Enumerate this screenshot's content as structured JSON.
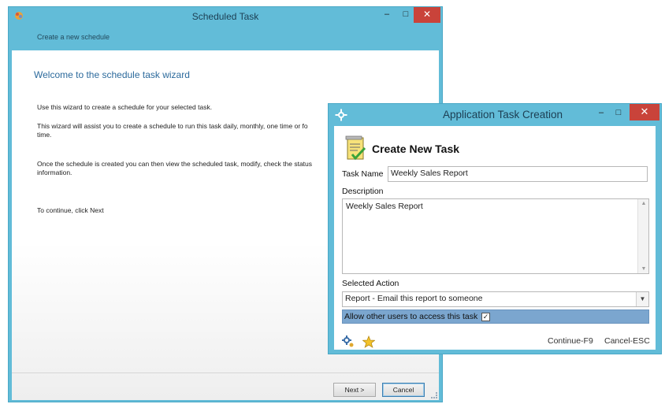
{
  "wizard": {
    "title": "Scheduled Task",
    "subheader": "Create a new schedule",
    "heading": "Welcome to the schedule task wizard",
    "para1": "Use this wizard to create a schedule for your selected task.",
    "para2_line1": "This wizard will assist you to create a schedule to run this task daily, monthly, one time or fo",
    "para2_line2": "time.",
    "para3_line1": "Once the schedule is created you can then view the scheduled task, modify, check the status",
    "para3_line2": "information.",
    "para4": "To continue, click Next",
    "next_label": "Next >",
    "cancel_label": "Cancel",
    "window_controls": {
      "minimize": "–",
      "maximize": "□",
      "close": "✕"
    }
  },
  "dialog": {
    "title": "Application Task Creation",
    "heading": "Create New Task",
    "task_name_label": "Task Name",
    "task_name_value": "Weekly Sales Report",
    "description_label": "Description",
    "description_value": "Weekly Sales Report",
    "selected_action_label": "Selected Action",
    "selected_action_value": "Report - Email this report to someone",
    "allow_label": "Allow other users to access this task",
    "allow_checked": true,
    "continue_label": "Continue-F9",
    "cancel_label": "Cancel-ESC",
    "window_controls": {
      "minimize": "–",
      "maximize": "□",
      "close": "✕"
    },
    "icons": [
      "gear-icon",
      "task-document-icon",
      "settings-icon",
      "star-icon"
    ]
  },
  "colors": {
    "chrome": "#62bcd8",
    "close_button": "#c9433a",
    "wizard_heading": "#2c6a9c",
    "highlight_row": "#7ba6cf"
  }
}
